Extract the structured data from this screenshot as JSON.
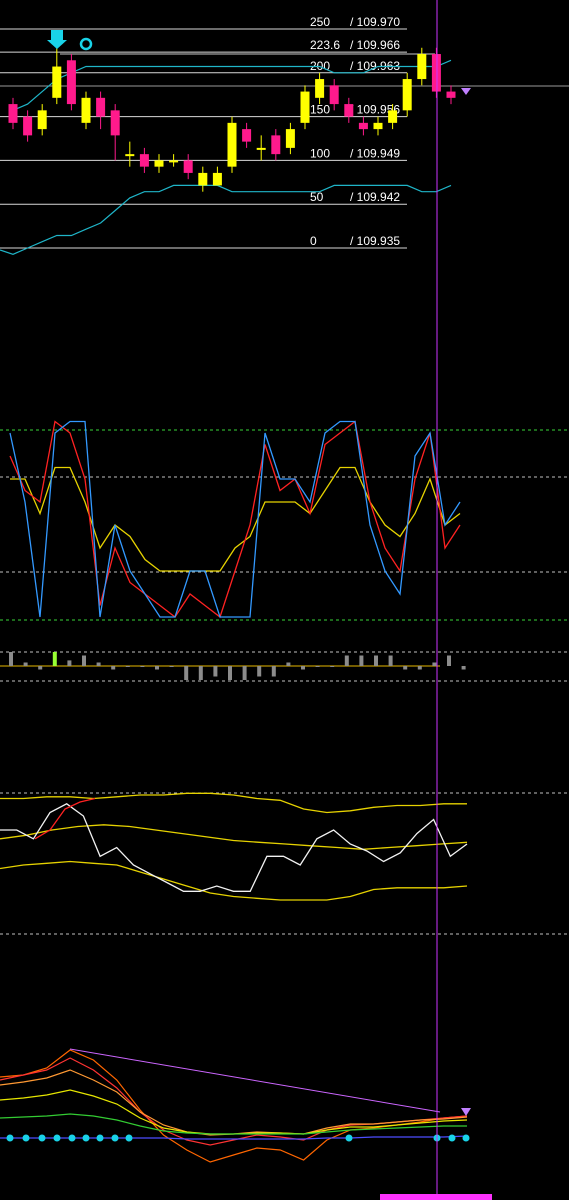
{
  "chart_data": {
    "type": "line",
    "price_panel": {
      "fib_levels": [
        {
          "level": "250",
          "price": "/ 109.970"
        },
        {
          "level": "223.6",
          "price": "/ 109.966"
        },
        {
          "level": "200",
          "price": "/ 109.963"
        },
        {
          "level": "150",
          "price": "/ 109.956"
        },
        {
          "level": "100",
          "price": "/ 109.949"
        },
        {
          "level": "50",
          "price": "/ 109.942"
        },
        {
          "level": "0",
          "price": "/ 109.935"
        }
      ],
      "candles": [
        [
          109.958,
          109.955,
          109.959,
          109.954
        ],
        [
          109.956,
          109.953,
          109.957,
          109.952
        ],
        [
          109.954,
          109.957,
          109.958,
          109.953
        ],
        [
          109.959,
          109.964,
          109.967,
          109.958
        ],
        [
          109.965,
          109.958,
          109.966,
          109.957
        ],
        [
          109.955,
          109.959,
          109.96,
          109.954
        ],
        [
          109.959,
          109.956,
          109.96,
          109.954
        ],
        [
          109.957,
          109.953,
          109.958,
          109.949
        ],
        [
          109.95,
          109.95,
          109.952,
          109.948
        ],
        [
          109.95,
          109.948,
          109.951,
          109.947
        ],
        [
          109.948,
          109.949,
          109.95,
          109.947
        ],
        [
          109.949,
          109.949,
          109.95,
          109.948
        ],
        [
          109.949,
          109.947,
          109.95,
          109.946
        ],
        [
          109.945,
          109.947,
          109.948,
          109.944
        ],
        [
          109.945,
          109.947,
          109.948,
          109.945
        ],
        [
          109.948,
          109.955,
          109.956,
          109.947
        ],
        [
          109.954,
          109.952,
          109.955,
          109.951
        ],
        [
          109.951,
          109.951,
          109.953,
          109.949
        ],
        [
          109.953,
          109.95,
          109.954,
          109.949
        ],
        [
          109.951,
          109.954,
          109.955,
          109.95
        ],
        [
          109.955,
          109.96,
          109.961,
          109.954
        ],
        [
          109.959,
          109.962,
          109.963,
          109.958
        ],
        [
          109.961,
          109.958,
          109.962,
          109.957
        ],
        [
          109.958,
          109.956,
          109.959,
          109.955
        ],
        [
          109.955,
          109.954,
          109.956,
          109.953
        ],
        [
          109.954,
          109.955,
          109.956,
          109.953
        ],
        [
          109.955,
          109.957,
          109.958,
          109.954
        ],
        [
          109.957,
          109.962,
          109.963,
          109.956
        ],
        [
          109.962,
          109.966,
          109.967,
          109.961
        ],
        [
          109.966,
          109.96,
          109.967,
          109.959
        ],
        [
          109.96,
          109.959,
          109.961,
          109.958
        ]
      ],
      "bollinger_upper": [
        109.957,
        109.958,
        109.96,
        109.962,
        109.963,
        109.964,
        109.964,
        109.964,
        109.964,
        109.964,
        109.964,
        109.964,
        109.964,
        109.964,
        109.964,
        109.964,
        109.964,
        109.964,
        109.964,
        109.964,
        109.964,
        109.964,
        109.963,
        109.963,
        109.963,
        109.964,
        109.964,
        109.964,
        109.964,
        109.964,
        109.965
      ],
      "bollinger_lower": [
        109.934,
        109.935,
        109.936,
        109.937,
        109.937,
        109.938,
        109.939,
        109.941,
        109.943,
        109.944,
        109.944,
        109.945,
        109.945,
        109.945,
        109.945,
        109.944,
        109.944,
        109.944,
        109.944,
        109.944,
        109.944,
        109.944,
        109.945,
        109.945,
        109.945,
        109.945,
        109.945,
        109.945,
        109.944,
        109.944,
        109.945
      ]
    },
    "stochastic_panel": {
      "blue": [
        90,
        60,
        10,
        90,
        95,
        95,
        10,
        50,
        30,
        20,
        10,
        10,
        30,
        30,
        10,
        10,
        10,
        90,
        70,
        70,
        60,
        90,
        95,
        95,
        50,
        30,
        20,
        80,
        90,
        50,
        60
      ],
      "red": [
        80,
        65,
        60,
        95,
        90,
        70,
        15,
        40,
        25,
        20,
        15,
        10,
        20,
        15,
        10,
        30,
        50,
        85,
        65,
        70,
        55,
        85,
        90,
        95,
        60,
        40,
        30,
        70,
        90,
        40,
        50
      ],
      "yellow": [
        70,
        70,
        55,
        75,
        75,
        60,
        40,
        50,
        45,
        35,
        30,
        30,
        30,
        30,
        30,
        40,
        45,
        60,
        60,
        60,
        55,
        65,
        75,
        75,
        60,
        50,
        45,
        55,
        70,
        50,
        55
      ],
      "histogram": [
        2,
        0.5,
        -0.5,
        2,
        0.8,
        1.5,
        0.5,
        -0.5,
        0,
        0,
        -0.5,
        0,
        -2,
        -2,
        -1.5,
        -2,
        -2,
        -1.5,
        -1.5,
        0.5,
        -0.5,
        0,
        0,
        1.5,
        1.5,
        1.5,
        1.5,
        -0.5,
        -0.5,
        0.5,
        1.5,
        -0.5
      ]
    },
    "rsi_panel": {
      "white": [
        60,
        60,
        55,
        70,
        75,
        68,
        45,
        50,
        40,
        35,
        30,
        25,
        25,
        28,
        25,
        25,
        45,
        45,
        40,
        55,
        60,
        52,
        48,
        42,
        47,
        58,
        66,
        45,
        52
      ],
      "red": [
        55,
        60,
        72,
        76,
        78
      ],
      "band_upper": [
        78,
        78,
        79,
        79,
        78,
        79,
        80,
        80,
        81,
        81,
        80,
        78,
        77,
        72,
        70,
        71,
        73,
        74,
        74,
        75,
        75
      ],
      "band_mid": [
        55,
        57,
        60,
        62,
        63,
        62,
        60,
        58,
        56,
        54,
        53,
        52,
        51,
        50,
        49,
        50,
        51,
        52,
        53
      ],
      "band_lower": [
        38,
        40,
        41,
        42,
        41,
        40,
        36,
        32,
        28,
        24,
        22,
        21,
        20,
        20,
        20,
        22,
        26,
        27,
        27,
        27,
        28
      ]
    },
    "ma_panel": {
      "cyan_dots_count": 13
    }
  }
}
